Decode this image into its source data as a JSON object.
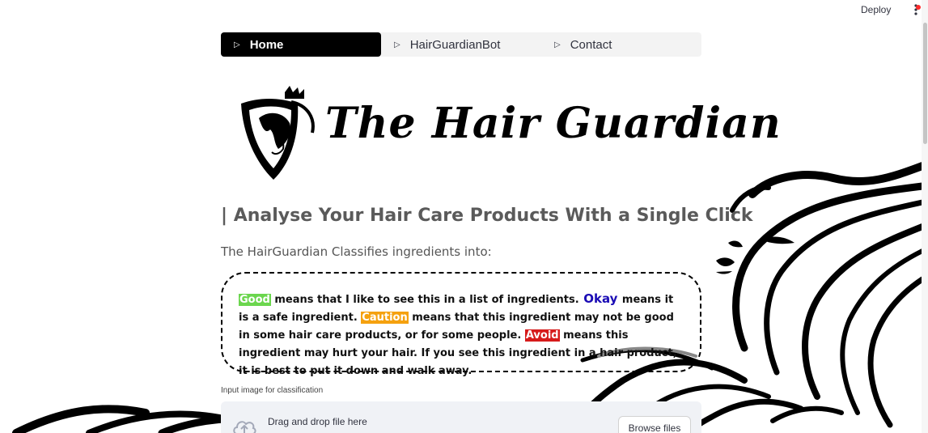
{
  "topbar": {
    "deploy_label": "Deploy",
    "menu_icon": "kebab-menu-icon"
  },
  "nav": {
    "items": [
      {
        "label": "Home",
        "icon": "play-triangle-icon",
        "active": true
      },
      {
        "label": "HairGuardianBot",
        "icon": "play-triangle-icon",
        "active": false
      },
      {
        "label": "Contact",
        "icon": "play-triangle-icon",
        "active": false
      }
    ]
  },
  "logo": {
    "text": "The Hair Guardian"
  },
  "main": {
    "subtitle": "| Analyse Your Hair Care Products With a Single Click",
    "classifies": "The HairGuardian Classifies ingredients into:"
  },
  "legend": {
    "good": "Good",
    "good_text": " means that I like to see this in a list of ingredients. ",
    "okay": "Okay",
    "okay_text": " means it is a safe ingredient. ",
    "caution": "Caution",
    "caution_text": " means that this ingredient may not be good in some hair care products, or for some people. ",
    "avoid": "Avoid",
    "avoid_text": " means this ingredient may hurt your hair. If you see this ingredient in a hair product, it is best to put it down and walk away."
  },
  "upload": {
    "label": "Input image for classification",
    "drag_text": "Drag and drop file here",
    "browse_label": "Browse files",
    "icon": "cloud-upload-icon"
  },
  "colors": {
    "good": "#6bd64e",
    "okay": "#1a0bb5",
    "caution": "#f5a10f",
    "avoid": "#d61b1b"
  }
}
